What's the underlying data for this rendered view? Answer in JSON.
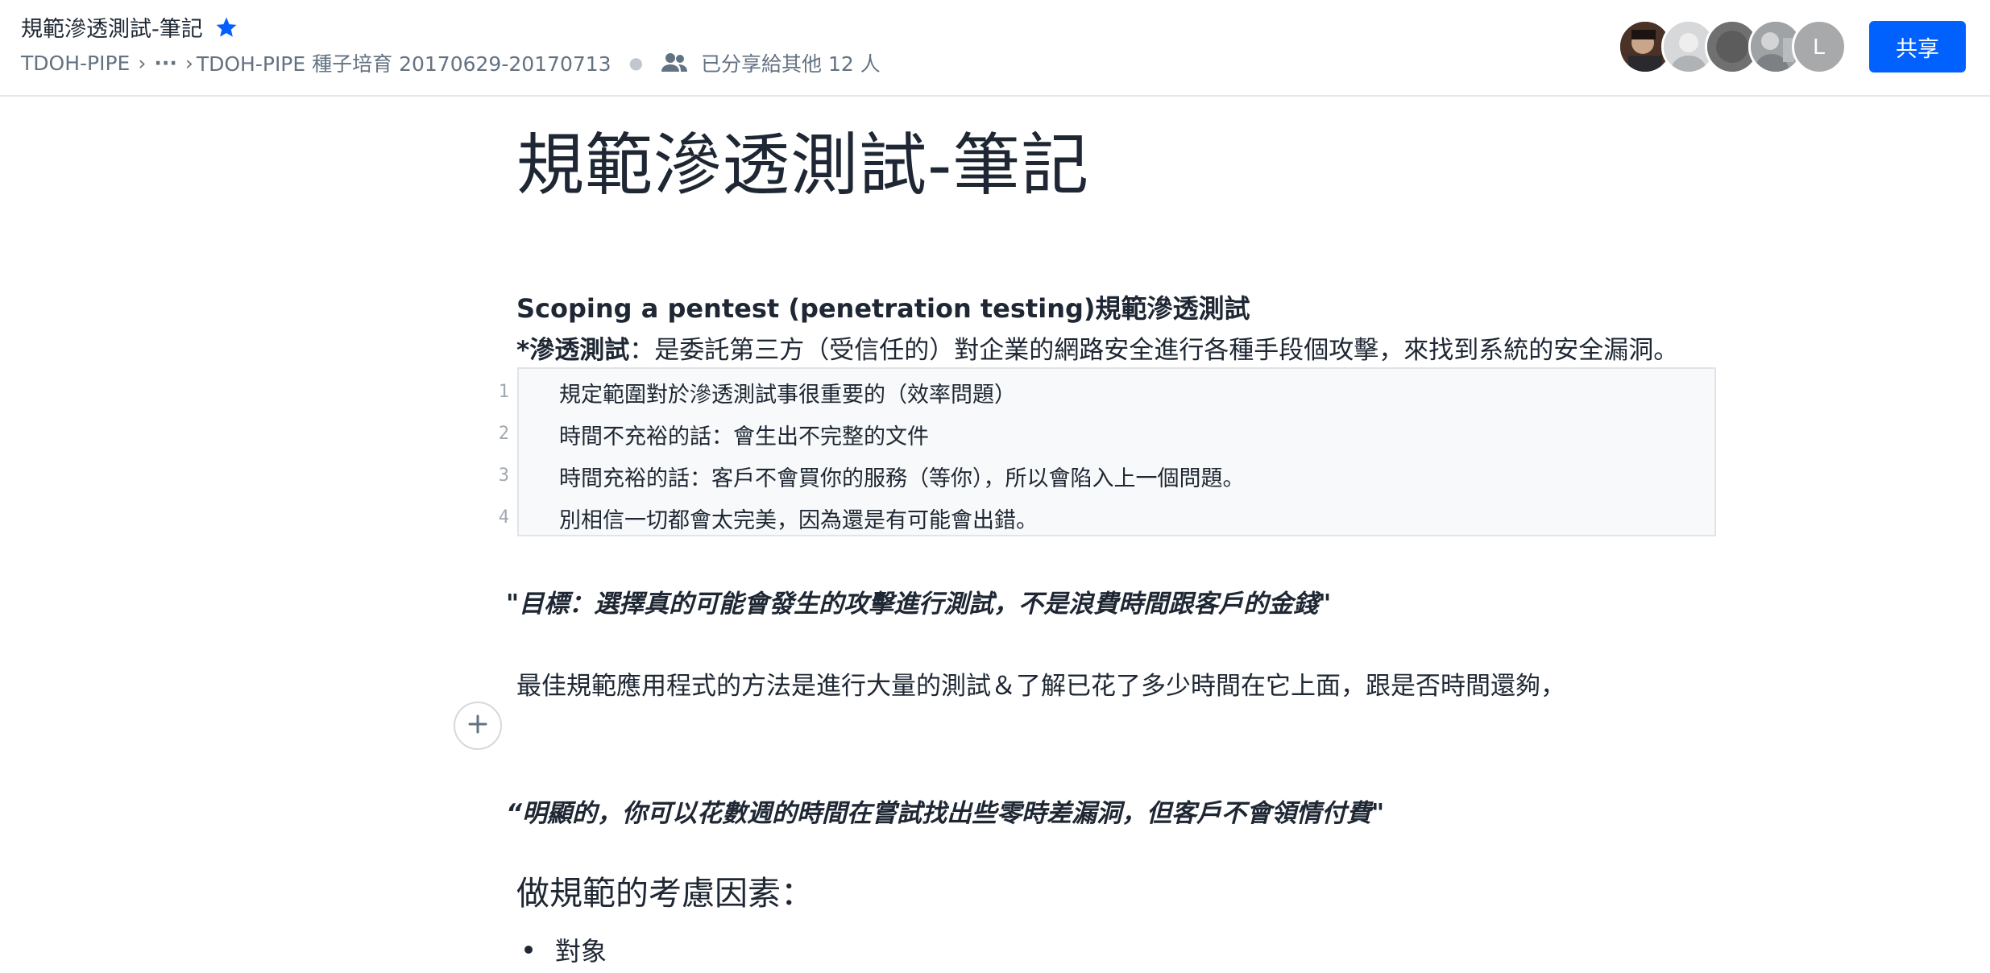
{
  "header": {
    "doc_title": "規範滲透測試-筆記",
    "breadcrumb": {
      "root": "TDOH-PIPE",
      "ellipsis": "···",
      "folder": "TDOH-PIPE 種子培育 20170629-20170713",
      "sep": "›"
    },
    "shared_text": "已分享給其他 12 人",
    "avatar_letter": "L",
    "share_label": "共享",
    "accent_color": "#0061fe"
  },
  "document": {
    "title": "規範滲透測試-筆記",
    "heading": "Scoping a pentest (penetration testing)規範滲透測試",
    "definition_term": "*滲透測試",
    "definition_text": "：是委託第三方（受信任的）對企業的網路安全進行各種手段個攻擊，來找到系統的安全漏洞。",
    "code_lines": [
      {
        "num": "1",
        "text": "規定範圍對於滲透測試事很重要的（效率問題）"
      },
      {
        "num": "2",
        "text": "時間不充裕的話：會生出不完整的文件"
      },
      {
        "num": "3",
        "text": "時間充裕的話：客戶不會買你的服務（等你），所以會陷入上一個問題。"
      },
      {
        "num": "4",
        "text": "別相信一切都會太完美，因為還是有可能會出錯。"
      }
    ],
    "quote1": "\"目標：選擇真的可能會發生的攻擊進行測試，不是浪費時間跟客戶的金錢\"",
    "paragraph": "最佳規範應用程式的方法是進行大量的測試＆了解已花了多少時間在它上面，跟是否時間還夠，",
    "quote2": "“明顯的，你可以花數週的時間在嘗試找出些零時差漏洞，但客戶不會領情付費\"",
    "subheading": "做規範的考慮因素：",
    "bullet": "對象"
  }
}
